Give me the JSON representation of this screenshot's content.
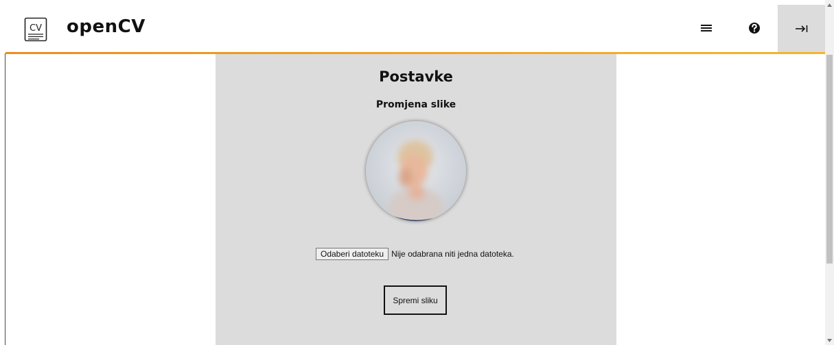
{
  "header": {
    "logo_text": "CV",
    "brand": "openCV",
    "icons": [
      "menu-icon",
      "help-icon",
      "sign-out-icon"
    ],
    "accent_color": "#f29b1f"
  },
  "main": {
    "title": "Postavke",
    "subtitle": "Promjena slike",
    "file_input": {
      "button_label": "Odaberi datoteku",
      "status": "Nije odabrana niti jedna datoteka."
    },
    "save_button": "Spremi sliku",
    "panel_color": "#dcdcdc"
  }
}
